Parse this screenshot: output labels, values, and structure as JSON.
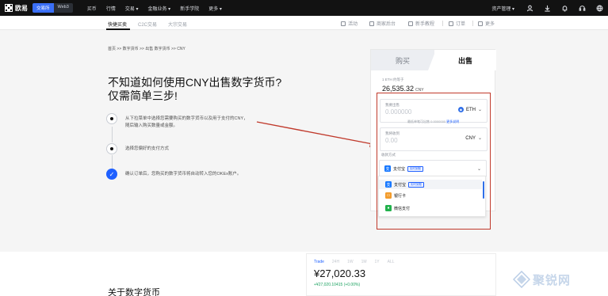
{
  "topnav": {
    "brand": "欧易",
    "toggle": [
      "交易所",
      "Web3"
    ],
    "links": [
      "买币",
      "行情",
      "交易 ▾",
      "金融业务 ▾",
      "新手学院",
      "更多 ▾"
    ],
    "asset_label": "资产管理 ▾"
  },
  "subnav": {
    "tabs": [
      "快捷买卖",
      "C2C交易",
      "大宗交易"
    ],
    "right": [
      "活动",
      "商家后台",
      "新手教程",
      "订单",
      "更多"
    ]
  },
  "breadcrumb": "首页 >> 数字货币 >> 出售 数字货币 >> CNY",
  "hero_title": [
    "不知道如何使用CNY出售数字货币?",
    "仅需简单三步!"
  ],
  "steps": [
    {
      "text": "从下拉菜单中选择您需要购买的数字货币以及用于支付的CNY，随后输入购买数量或金额。"
    },
    {
      "text": "选择您偏好的支付方式"
    },
    {
      "text": "确认订单后，您购买的数字货币将自动转入您的OKEx账户。"
    }
  ],
  "card": {
    "tab_buy": "购买",
    "tab_sell": "出售",
    "rate_label": "1 ETH 约等于",
    "rate_value": "26,535.32",
    "rate_unit": "CNY",
    "sell_label": "我要出售",
    "sell_placeholder": "0.000000",
    "sell_coin": "ETH",
    "min_hint": "最低单笔可出售 0.0000000",
    "min_link": "更多说明",
    "receive_label": "我将收到",
    "receive_placeholder": "0.00",
    "receive_currency": "CNY",
    "pay_label": "收款方式",
    "pay_selected": "支付宝",
    "pay_badge": "实时到账",
    "options": [
      {
        "name": "支付宝",
        "badge": "实时到账",
        "icon": "alipay-icon"
      },
      {
        "name": "银行卡",
        "badge": "",
        "icon": "bank-card-icon"
      },
      {
        "name": "微信支付",
        "badge": "",
        "icon": "wechat-pay-icon"
      }
    ]
  },
  "about_title": "关于数字货币",
  "market": {
    "tabs": [
      "Trade",
      "24H",
      "1W",
      "1M",
      "1Y",
      "ALL"
    ],
    "price": "¥27,020.33",
    "change": "+¥27,020.10415 (+0.00%)"
  },
  "watermark": "聚锐网",
  "colors": {
    "accent": "#1f60ff",
    "annotation_red": "#c0392b",
    "topnav_bg": "#121212"
  }
}
